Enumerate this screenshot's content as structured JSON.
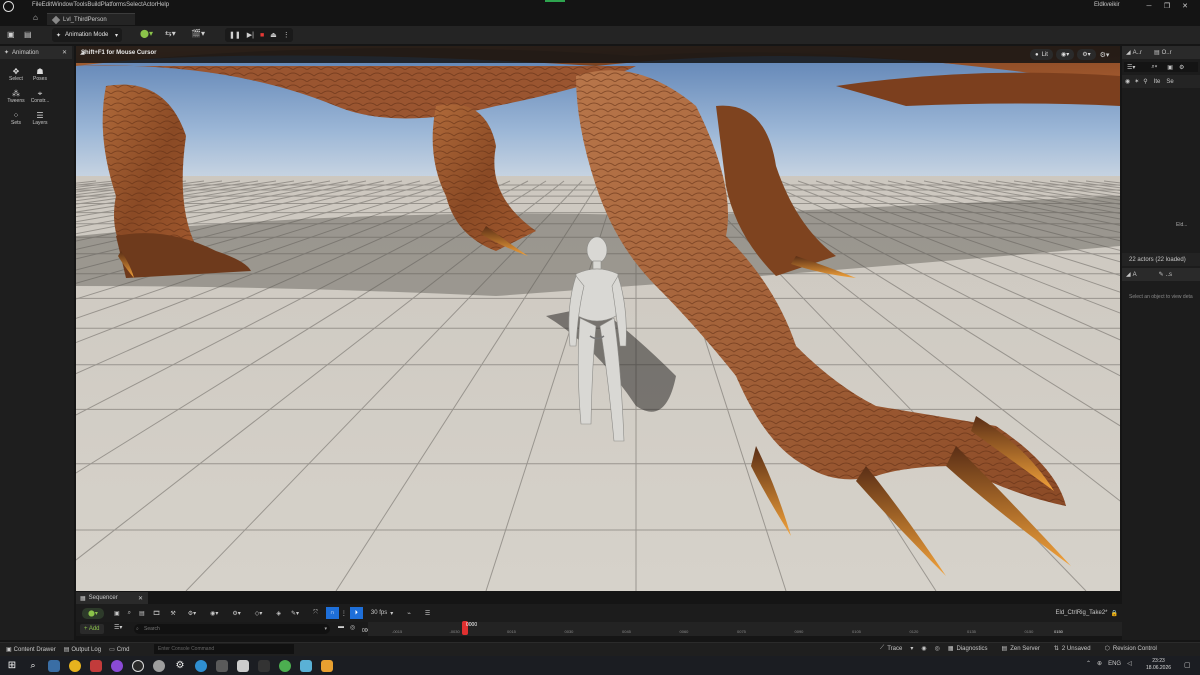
{
  "menu": {
    "items": [
      "File",
      "Edit",
      "Window",
      "Tools",
      "Build",
      "Platforms",
      "Select",
      "Actor",
      "Help"
    ],
    "user": "Eldkveikir"
  },
  "tabs": {
    "level": "Lvl_ThirdPerson"
  },
  "toolbar": {
    "mode_label": "Animation Mode"
  },
  "left_panel": {
    "tab_label": "Animation",
    "tools": [
      {
        "label": "Select",
        "icon": "select-icon"
      },
      {
        "label": "Poses",
        "icon": "poses-icon"
      },
      {
        "label": "Tweens",
        "icon": "tweens-icon"
      },
      {
        "label": "Constr...",
        "icon": "constraints-icon"
      },
      {
        "label": "Sets",
        "icon": "sets-icon"
      },
      {
        "label": "Layers",
        "icon": "layers-icon"
      }
    ]
  },
  "viewport": {
    "hint": "Shift+F1 for Mouse Cursor",
    "lit_label": "Lit"
  },
  "outliner": {
    "tab1": "A..r",
    "tab2": "O..r",
    "col_label": "Ite",
    "col2": "Se",
    "side_text": "Eld...",
    "actors_count": "22 actors (22 loaded)"
  },
  "details": {
    "tab1": "A",
    "tab2": "..s",
    "hint": "Select an object to view deta"
  },
  "sequencer": {
    "tab_label": "Sequencer",
    "fps_label": "30 fps",
    "sequence_name": "Eld_CtrlRig_Take2*",
    "add_label": "+ Add",
    "search_placeholder": "Search",
    "current_frame": "0000",
    "start_frame": "0000",
    "ticks": [
      "-0015",
      "-0030",
      "0015",
      "0030",
      "0045",
      "0060",
      "0075",
      "0090",
      "0105",
      "0120",
      "0135",
      "0150"
    ],
    "end_frame": "0150"
  },
  "statusbar": {
    "content_drawer": "Content Drawer",
    "output_log": "Output Log",
    "cmd": "Cmd",
    "console_placeholder": "Enter Console Command",
    "trace": "Trace",
    "diagnostics": "Diagnostics",
    "zen_server": "Zen Server",
    "unsaved": "2 Unsaved",
    "revision_control": "Revision Control"
  },
  "taskbar": {
    "lang": "ENG",
    "time": "23:23",
    "date": "18.06.2026"
  }
}
